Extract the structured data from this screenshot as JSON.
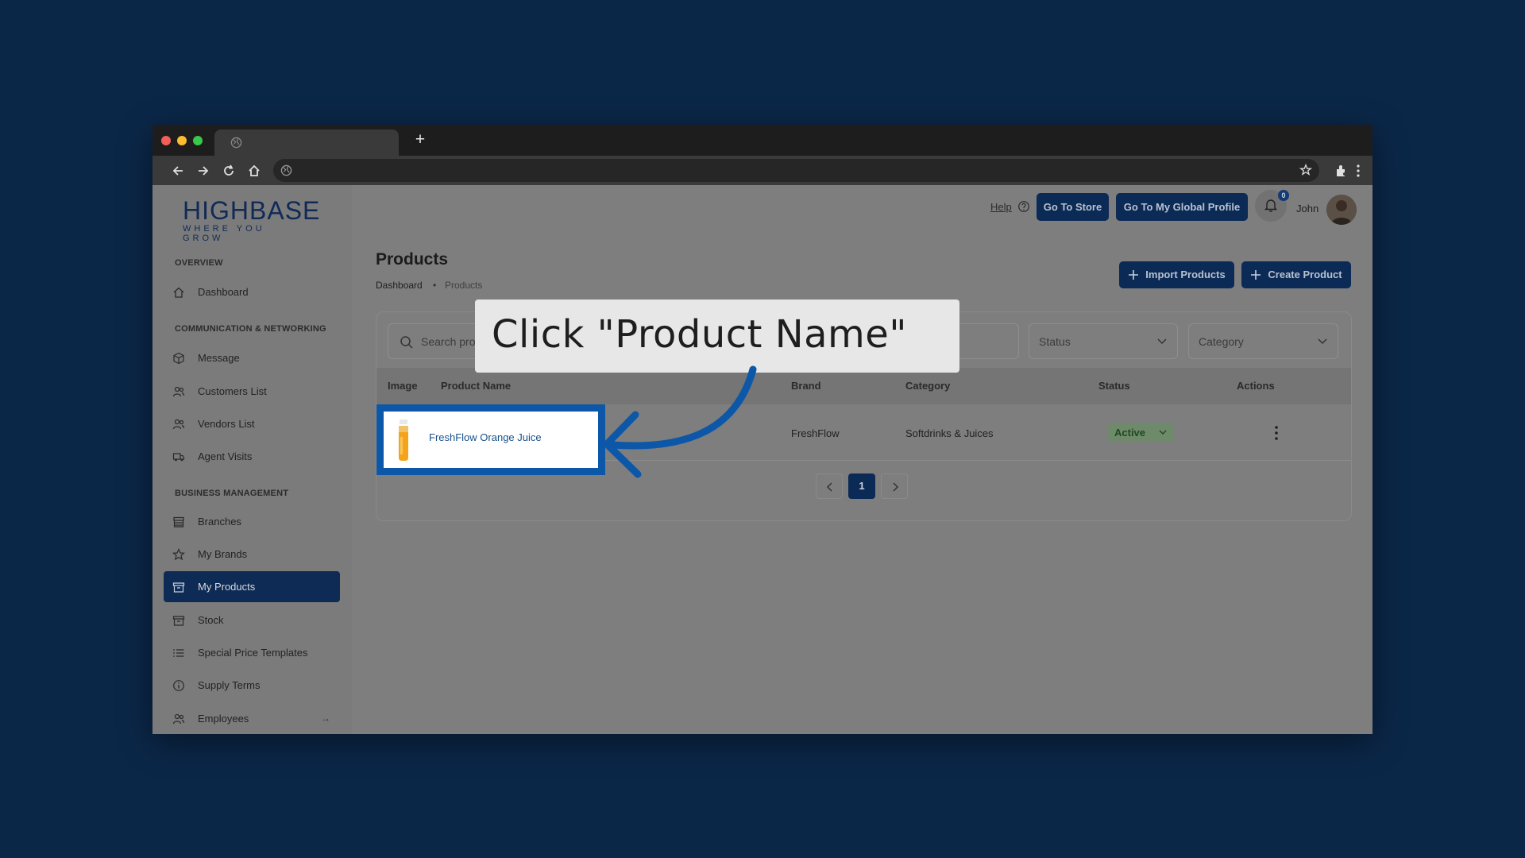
{
  "browser": {
    "new_tab_symbol": "+"
  },
  "logo": {
    "main": "HIGHBASE",
    "tagline": "WHERE YOU GROW"
  },
  "sidebar": {
    "sections": [
      {
        "label": "OVERVIEW"
      },
      {
        "label": "COMMUNICATION & NETWORKING"
      },
      {
        "label": "BUSINESS MANAGEMENT"
      }
    ],
    "items": [
      {
        "label": "Dashboard",
        "icon": "home-icon"
      },
      {
        "label": "Message",
        "icon": "cube-icon"
      },
      {
        "label": "Customers List",
        "icon": "users-icon"
      },
      {
        "label": "Vendors List",
        "icon": "users-icon"
      },
      {
        "label": "Agent Visits",
        "icon": "truck-icon"
      },
      {
        "label": "Branches",
        "icon": "store-icon"
      },
      {
        "label": "My Brands",
        "icon": "star-icon"
      },
      {
        "label": "My Products",
        "icon": "box-icon",
        "active": true
      },
      {
        "label": "Stock",
        "icon": "archive-icon"
      },
      {
        "label": "Special Price Templates",
        "icon": "list-icon"
      },
      {
        "label": "Supply Terms",
        "icon": "info-icon"
      },
      {
        "label": "Employees",
        "icon": "users-icon",
        "arrow": "→"
      }
    ]
  },
  "header": {
    "help": "Help",
    "go_to_store": "Go To Store",
    "go_to_global_profile": "Go To My Global Profile",
    "notification_count": "0",
    "user_name": "John"
  },
  "page": {
    "title": "Products",
    "breadcrumb": [
      "Dashboard",
      "•",
      "Products"
    ],
    "import_button": "Import Products",
    "create_button": "Create Product"
  },
  "filters": {
    "search_placeholder": "Search produ",
    "status": "Status",
    "category": "Category"
  },
  "table": {
    "columns": [
      "Image",
      "Product Name",
      "Brand",
      "Category",
      "Status",
      "Actions"
    ],
    "rows": [
      {
        "product_name": "FreshFlow Orange Juice",
        "brand": "FreshFlow",
        "category": "Softdrinks & Juices",
        "status": "Active"
      }
    ]
  },
  "pagination": {
    "current": "1"
  },
  "callout": {
    "text": "Click \"Product Name\""
  },
  "colors": {
    "background": "#0b2748",
    "primary": "#0b2a55",
    "highlight": "#0d57a8"
  }
}
